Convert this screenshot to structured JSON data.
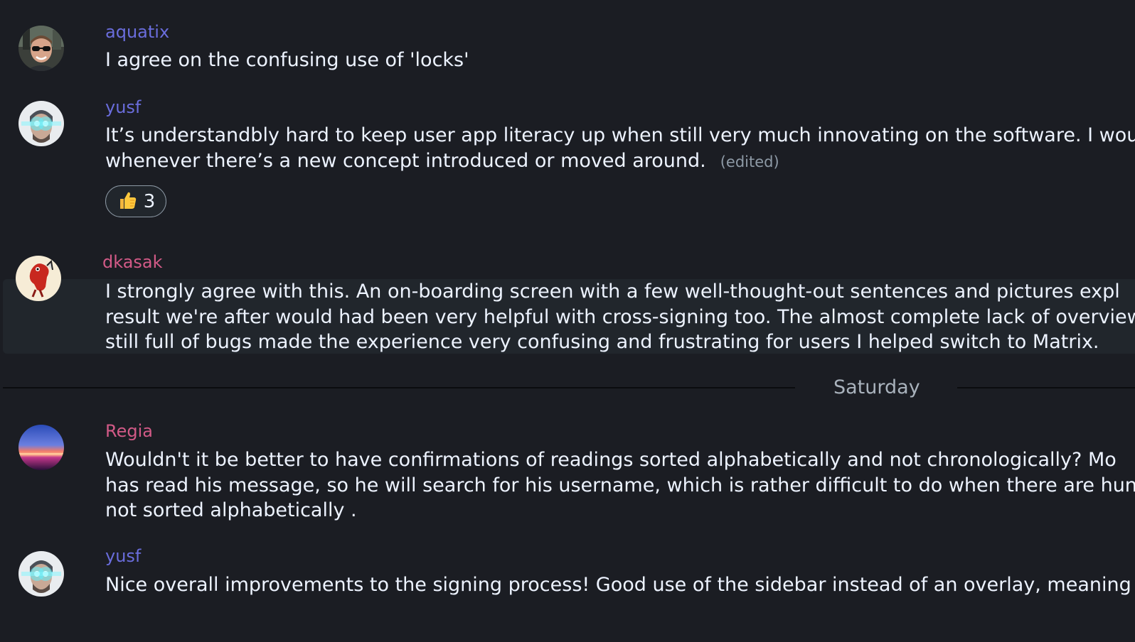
{
  "messages": [
    {
      "sender": "aquatix",
      "lines": [
        "I agree on the confusing use of 'locks'"
      ],
      "avatar_icon": "avatar-photo-sunglasses"
    },
    {
      "sender": "yusf",
      "lines": [
        "It’s understandbly hard to keep user app literacy up when still very much innovating on the software. I wou",
        "whenever there’s a new concept introduced or moved around."
      ],
      "edited_label": "(edited)",
      "reaction": {
        "emoji": "👍",
        "count": "3"
      },
      "avatar_icon": "avatar-glowing-eyes"
    },
    {
      "sender": "dkasak",
      "lines": [
        "I strongly agree with this. An on-boarding screen with a few well-thought-out sentences and pictures expl",
        "result we're after would had been very helpful with cross-signing too. The almost complete lack of overview",
        "still full of bugs made the experience very confusing and frustrating for users I helped switch to Matrix."
      ],
      "avatar_icon": "avatar-red-creature"
    },
    {
      "sender": "Regia",
      "lines": [
        "Wouldn't it be better to have confirmations of readings sorted alphabetically and not chronologically?    Mo",
        "has read his message, so he will search for his username, which is rather difficult to do when there are hun",
        "not sorted alphabetically ."
      ],
      "avatar_icon": "avatar-sunset"
    },
    {
      "sender": "yusf",
      "lines": [
        "Nice overall improvements to the signing process! Good use of the sidebar instead of an overlay, meaning u"
      ],
      "avatar_icon": "avatar-glowing-eyes"
    }
  ],
  "date_separator": "Saturday",
  "colors": {
    "background": "#1b1d23",
    "highlight_background": "#21262c",
    "sender_blue": "#6a6ddc",
    "sender_pink": "#d25a87",
    "body_text": "#edf3ff",
    "muted_text": "#8d99a5"
  }
}
